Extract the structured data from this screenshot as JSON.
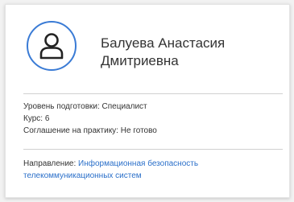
{
  "student": {
    "name": "Балуева Анастасия Дмитриевна",
    "level_label": "Уровень подготовки:",
    "level_value": "Специалист",
    "course_label": "Курс:",
    "course_value": "6",
    "agreement_label": "Соглашение на практику:",
    "agreement_value": "Не готово",
    "direction_label": "Направление:",
    "direction_value": "Информационная безопасность телекоммуникационных систем"
  },
  "icons": {
    "avatar": "user-icon"
  },
  "colors": {
    "accent": "#3a7bd5",
    "link": "#2a6fc9"
  }
}
